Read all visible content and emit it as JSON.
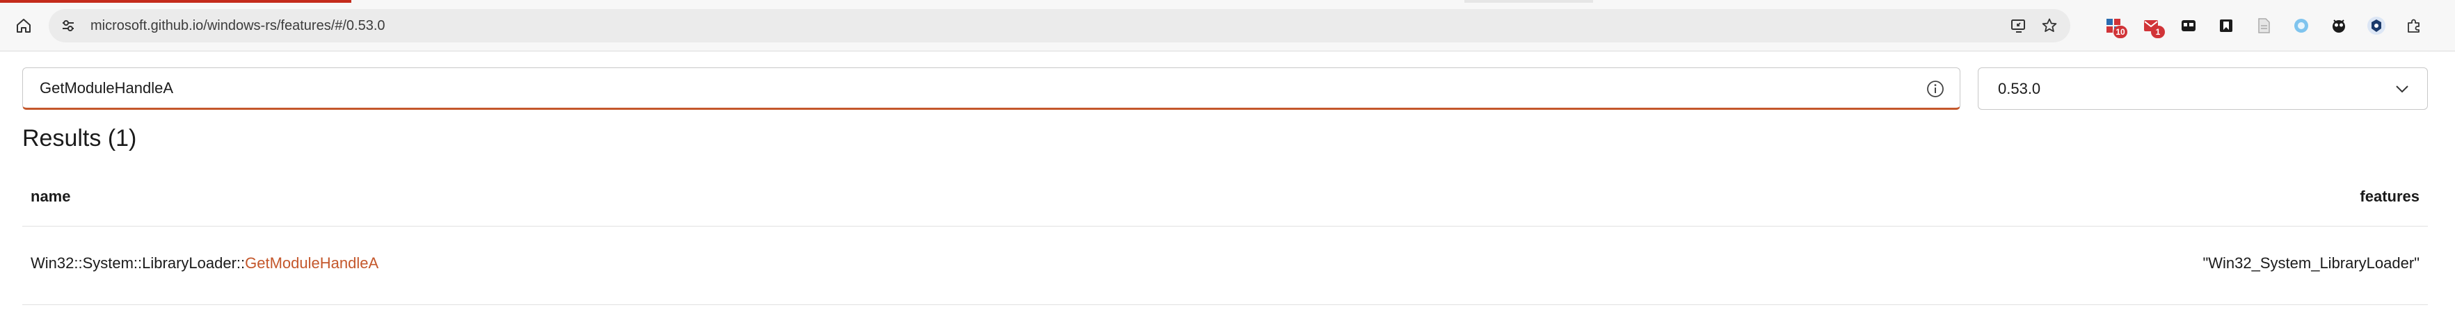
{
  "browser": {
    "url": "microsoft.github.io/windows-rs/features/#/0.53.0",
    "progress_colors": [
      "#c42b1c",
      "#e6e6e6"
    ],
    "icons": {
      "home": "home-icon",
      "site_info": "site-settings-icon",
      "install_app": "install-app-icon",
      "favorite": "star-icon"
    },
    "extensions": [
      {
        "name": "extension-grid-icon",
        "badge": "10"
      },
      {
        "name": "extension-mail-icon",
        "badge": "1"
      },
      {
        "name": "extension-tabs-icon",
        "badge": ""
      },
      {
        "name": "extension-bookmark-icon",
        "badge": ""
      },
      {
        "name": "extension-document-icon",
        "badge": ""
      },
      {
        "name": "extension-circle-icon",
        "badge": ""
      },
      {
        "name": "extension-owl-icon",
        "badge": ""
      },
      {
        "name": "extension-shield-icon",
        "badge": ""
      },
      {
        "name": "extensions-puzzle-icon",
        "badge": ""
      }
    ]
  },
  "search": {
    "value": "GetModuleHandleA",
    "info_icon": "info-icon"
  },
  "version": {
    "selected": "0.53.0",
    "chevron_icon": "chevron-down-icon"
  },
  "results": {
    "heading": "Results (1)",
    "columns": [
      "name",
      "features"
    ],
    "rows": [
      {
        "name_prefix": "Win32::System::LibraryLoader::",
        "name_link": "GetModuleHandleA",
        "features": "\"Win32_System_LibraryLoader\""
      }
    ]
  },
  "colors": {
    "accent": "#c4572b",
    "text": "#1b1b1b",
    "badge": "#d13438"
  }
}
